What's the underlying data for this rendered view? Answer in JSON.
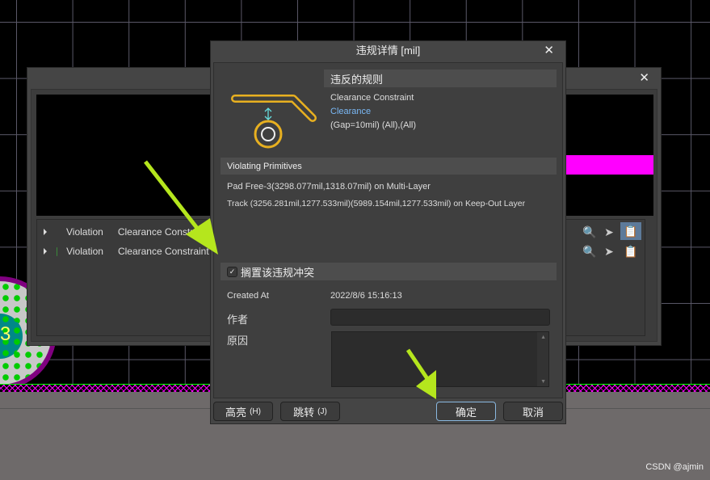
{
  "background_window": {
    "rows": [
      {
        "type": "Violation",
        "rule": "Clearance Constraint (0..."
      },
      {
        "type": "Violation",
        "rule": "Clearance Constraint ("
      }
    ],
    "pad_label": "3"
  },
  "dialog": {
    "title": "违规详情 [mil]",
    "rule_header": "违反的规则",
    "rule_name": "Clearance Constraint",
    "rule_link": "Clearance",
    "rule_detail": "(Gap=10mil) (All),(All)",
    "primitives_header": "Violating Primitives",
    "primitives": [
      "Pad Free-3(3298.077mil,1318.07mil) on Multi-Layer",
      "Track (3256.281mil,1277.533mil)(5989.154mil,1277.533mil) on Keep-Out Layer"
    ],
    "waive_label": "搁置该违规冲突",
    "waive_checked": true,
    "created_at_label": "Created At",
    "created_at": "2022/8/6 15:16:13",
    "author_label": "作者",
    "author_value": "",
    "reason_label": "原因",
    "reason_value": "",
    "buttons": {
      "highlight": "高亮",
      "highlight_key": "(H)",
      "jump": "跳转",
      "jump_key": "(J)",
      "ok": "确定",
      "cancel": "取消"
    }
  },
  "watermark": "CSDN @ajmin",
  "colors": {
    "accent_link": "#7ab8f5",
    "arrow": "#b5e61d",
    "magenta": "#ff00ff"
  }
}
